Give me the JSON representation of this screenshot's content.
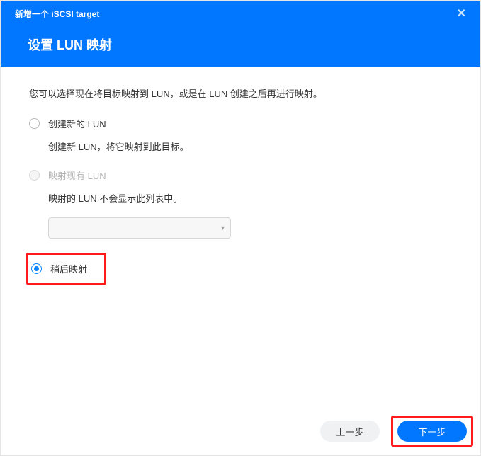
{
  "header": {
    "window_title": "新增一个 iSCSI target",
    "page_title": "设置 LUN 映射"
  },
  "content": {
    "intro": "您可以选择现在将目标映射到 LUN，或是在 LUN 创建之后再进行映射。",
    "options": {
      "create": {
        "label": "创建新的 LUN",
        "desc": "创建新 LUN，将它映射到此目标。"
      },
      "existing": {
        "label": "映射现有 LUN",
        "desc": "映射的 LUN 不会显示此列表中。",
        "select_value": ""
      },
      "later": {
        "label": "稍后映射"
      }
    }
  },
  "footer": {
    "back": "上一步",
    "next": "下一步"
  }
}
